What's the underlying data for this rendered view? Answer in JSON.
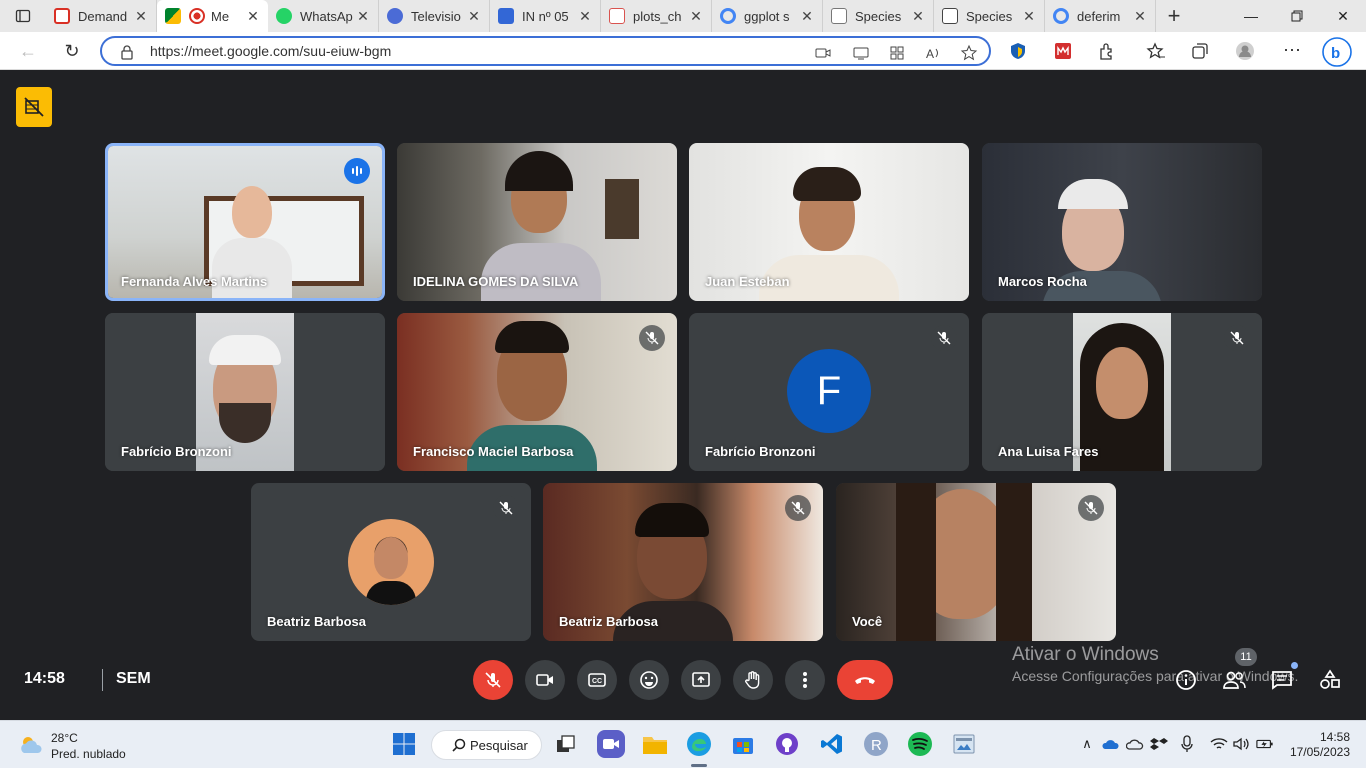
{
  "browser": {
    "tabs": [
      {
        "title": "Demand",
        "color": "#d93025"
      },
      {
        "title": "Me",
        "color": "#00832d",
        "active": true
      },
      {
        "title": "WhatsAp",
        "color": "#25d366"
      },
      {
        "title": "Televisio",
        "color": "#4b6bd6"
      },
      {
        "title": "IN nº 05",
        "color": "#3367d6"
      },
      {
        "title": "plots_ch",
        "color": "#d9534f"
      },
      {
        "title": "ggplot s",
        "color": "#4285f4"
      },
      {
        "title": "Species",
        "color": "#777777"
      },
      {
        "title": "Species",
        "color": "#444444"
      },
      {
        "title": "deferim",
        "color": "#4285f4"
      }
    ],
    "url": "https://meet.google.com/suu-eiuw-bgm"
  },
  "meet": {
    "participants": [
      {
        "name": "Fernanda Alves Martins",
        "speaking": true
      },
      {
        "name": "IDELINA GOMES DA SILVA"
      },
      {
        "name": "Juan Esteban"
      },
      {
        "name": "Marcos Rocha"
      },
      {
        "name": "Fabrício Bronzoni",
        "muted": true
      },
      {
        "name": "Francisco Maciel Barbosa",
        "muted": true
      },
      {
        "name": "Fabrício Bronzoni",
        "muted": true,
        "avatar_letter": "F"
      },
      {
        "name": "Ana Luisa Fares",
        "muted": true
      },
      {
        "name": "Beatriz Barbosa",
        "muted": true
      },
      {
        "name": "Beatriz Barbosa",
        "muted": true
      },
      {
        "name": "Você",
        "muted": true
      }
    ],
    "time": "14:58",
    "code": "SEM",
    "people_count": "11",
    "watermark_title": "Ativar o Windows",
    "watermark_sub": "Acesse Configurações para ativar o Windows."
  },
  "taskbar": {
    "temperature": "28°C",
    "condition": "Pred. nublado",
    "search_label": "Pesquisar",
    "clock_time": "14:58",
    "clock_date": "17/05/2023"
  }
}
